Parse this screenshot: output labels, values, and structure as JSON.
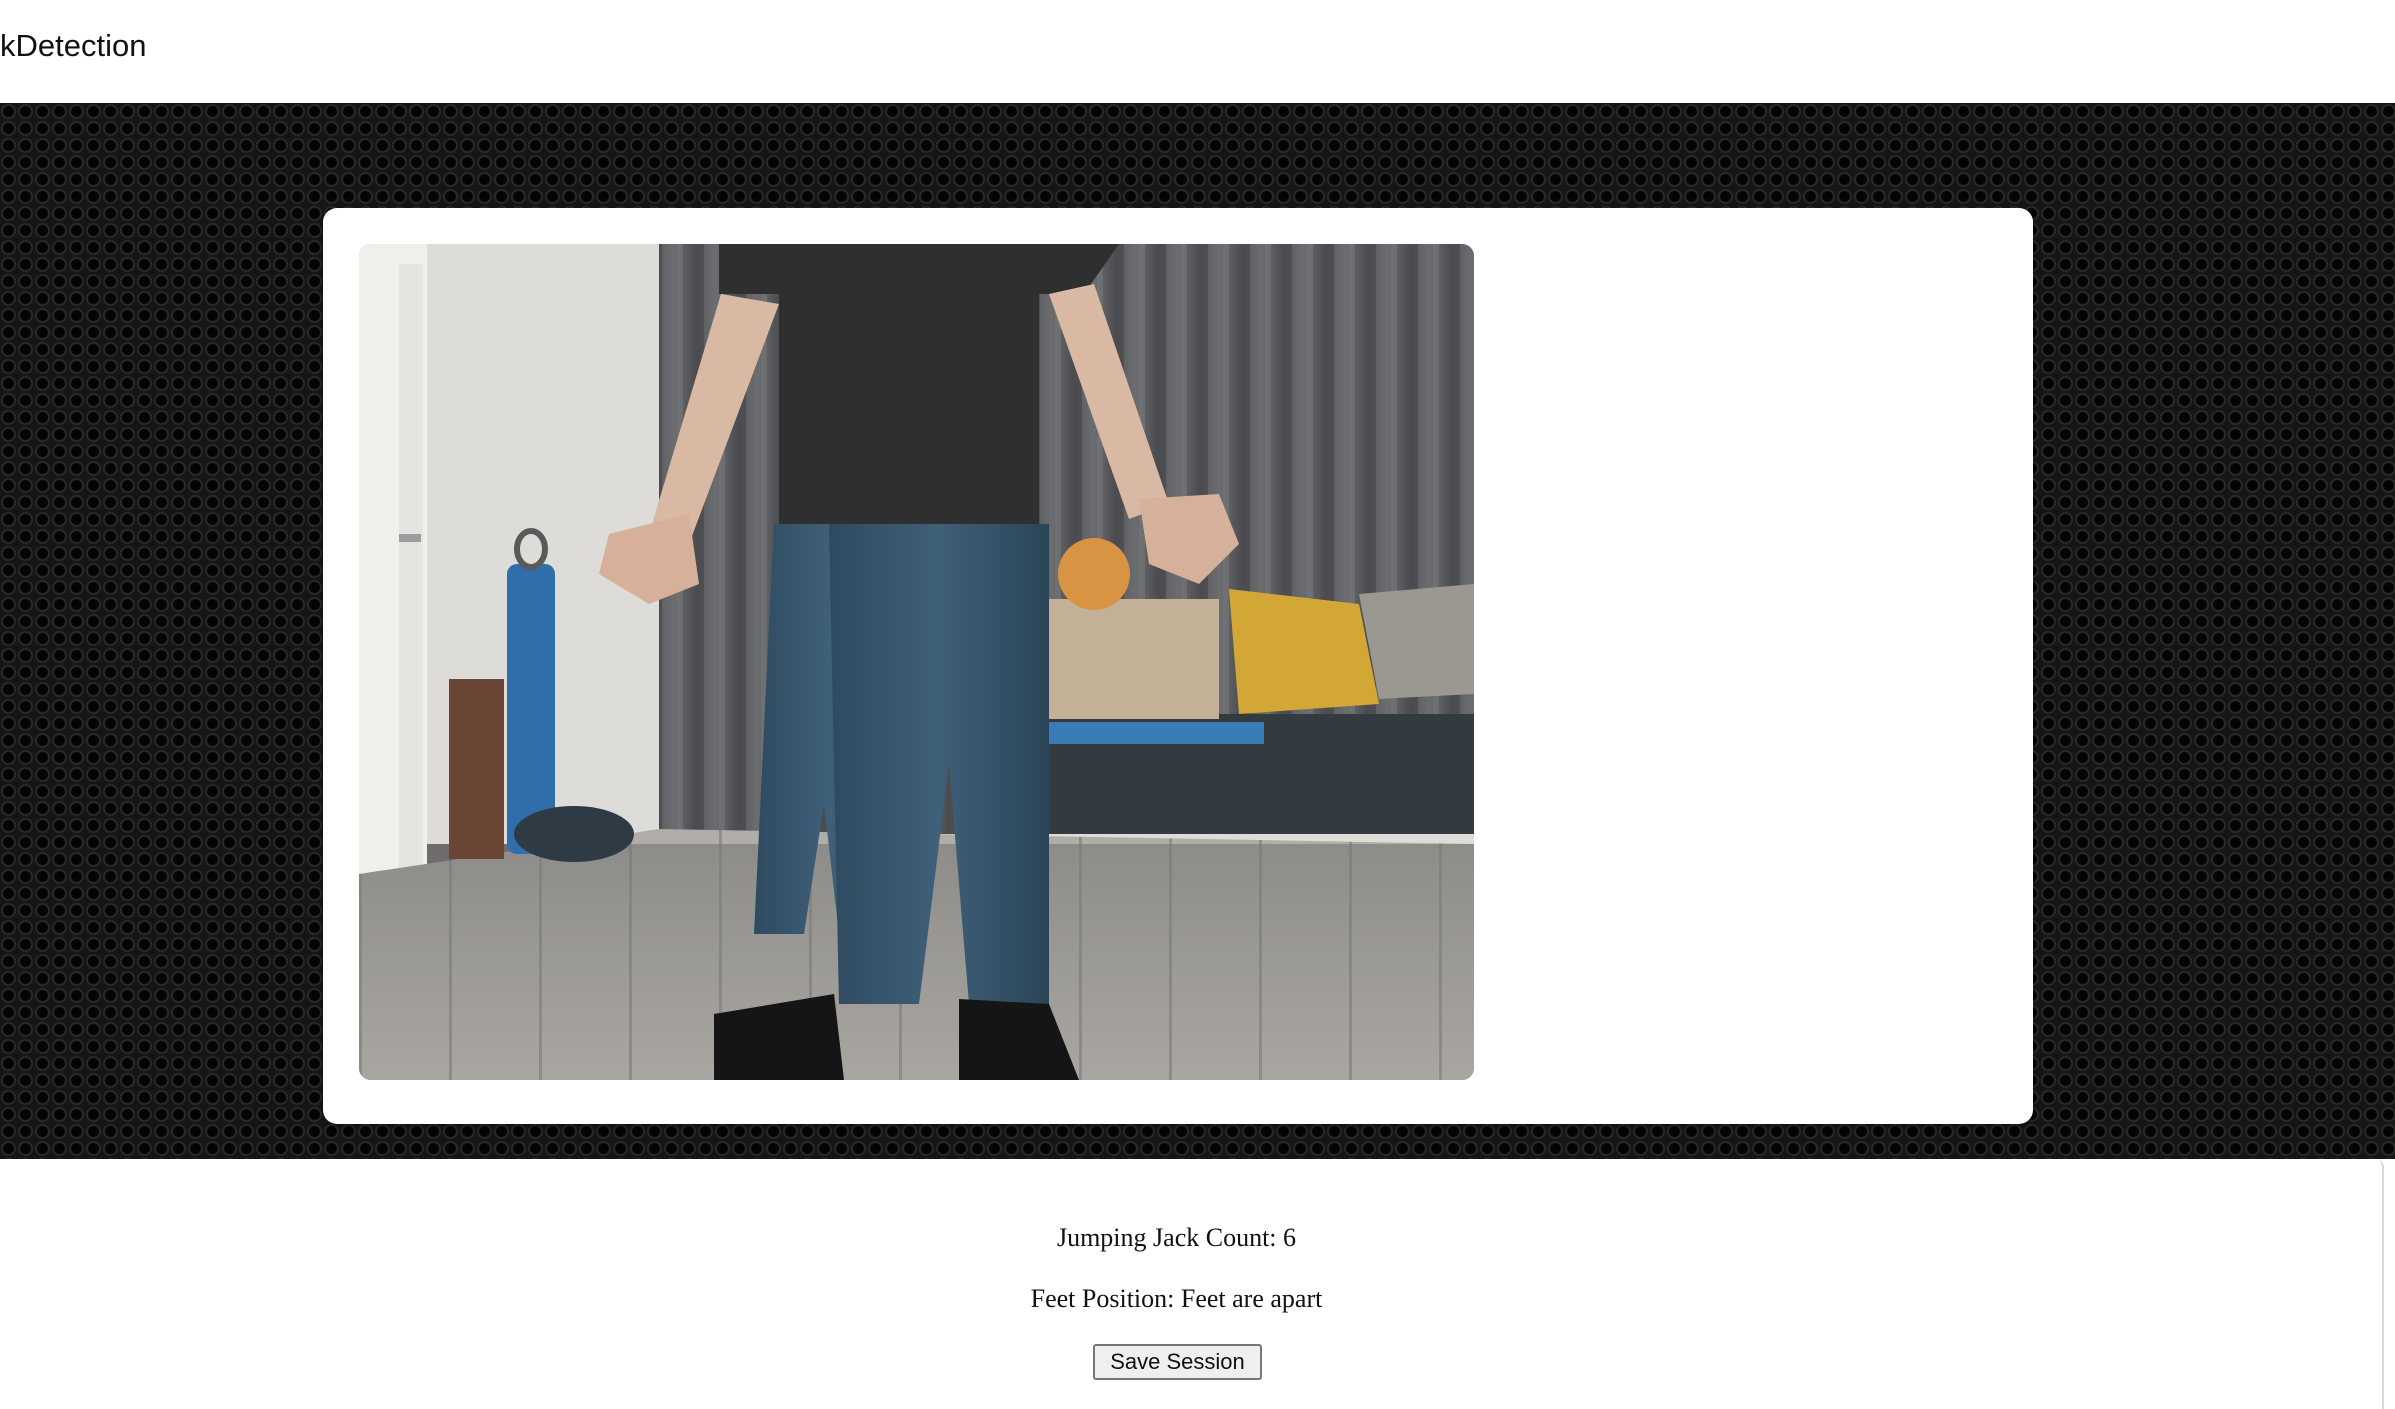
{
  "navbar": {
    "brand": "kDetection"
  },
  "webcam": {
    "feed": "live-camera-feed"
  },
  "status": {
    "count_label": "Jumping Jack Count: 6",
    "feet_label": "Feet Position: Feet are apart"
  },
  "actions": {
    "save_label": "Save Session"
  }
}
